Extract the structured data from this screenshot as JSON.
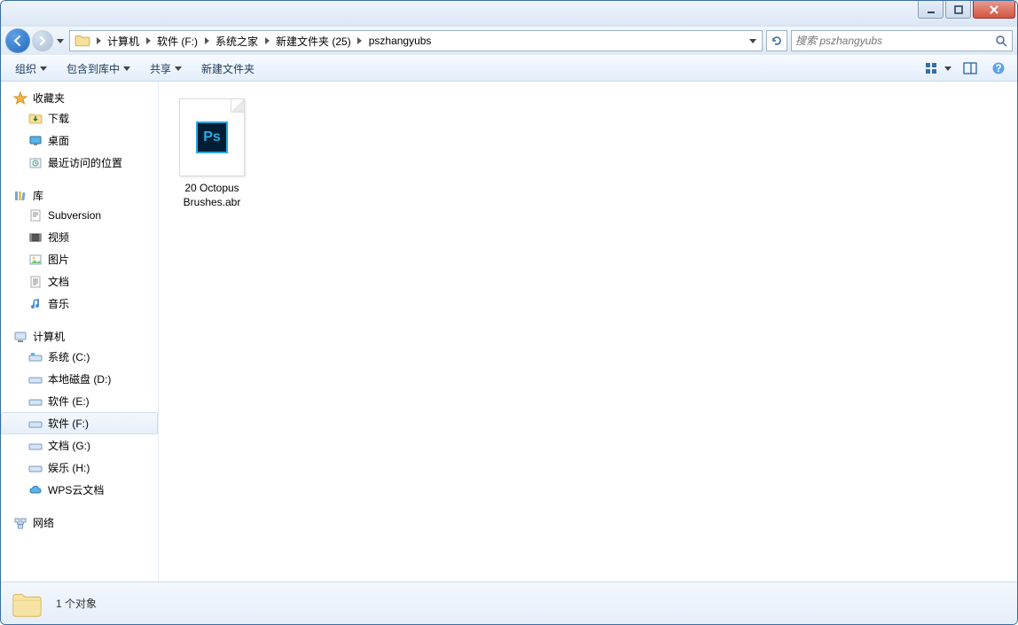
{
  "breadcrumb": {
    "items": [
      {
        "label": "计算机"
      },
      {
        "label": "软件 (F:)"
      },
      {
        "label": "系统之家"
      },
      {
        "label": "新建文件夹 (25)"
      },
      {
        "label": "pszhangyubs"
      }
    ]
  },
  "search": {
    "placeholder": "搜索 pszhangyubs"
  },
  "toolbar": {
    "organize": "组织",
    "include": "包含到库中",
    "share": "共享",
    "newfolder": "新建文件夹"
  },
  "sidebar": {
    "favorites": {
      "label": "收藏夹",
      "items": [
        {
          "label": "下载",
          "icon": "download-icon"
        },
        {
          "label": "桌面",
          "icon": "desktop-icon"
        },
        {
          "label": "最近访问的位置",
          "icon": "recent-icon"
        }
      ]
    },
    "libraries": {
      "label": "库",
      "items": [
        {
          "label": "Subversion",
          "icon": "svn-icon"
        },
        {
          "label": "视频",
          "icon": "video-icon"
        },
        {
          "label": "图片",
          "icon": "picture-icon"
        },
        {
          "label": "文档",
          "icon": "document-icon"
        },
        {
          "label": "音乐",
          "icon": "music-icon"
        }
      ]
    },
    "computer": {
      "label": "计算机",
      "items": [
        {
          "label": "系统 (C:)",
          "icon": "drive-sys-icon"
        },
        {
          "label": "本地磁盘 (D:)",
          "icon": "drive-icon"
        },
        {
          "label": "软件 (E:)",
          "icon": "drive-icon"
        },
        {
          "label": "软件 (F:)",
          "icon": "drive-icon",
          "selected": true
        },
        {
          "label": "文档 (G:)",
          "icon": "drive-icon"
        },
        {
          "label": "娱乐 (H:)",
          "icon": "drive-icon"
        },
        {
          "label": "WPS云文档",
          "icon": "cloud-icon"
        }
      ]
    },
    "network": {
      "label": "网络"
    }
  },
  "files": [
    {
      "name": "20 Octopus Brushes.abr",
      "type": "abr"
    }
  ],
  "status": {
    "text": "1 个对象"
  },
  "icons": {
    "ps": "Ps"
  }
}
